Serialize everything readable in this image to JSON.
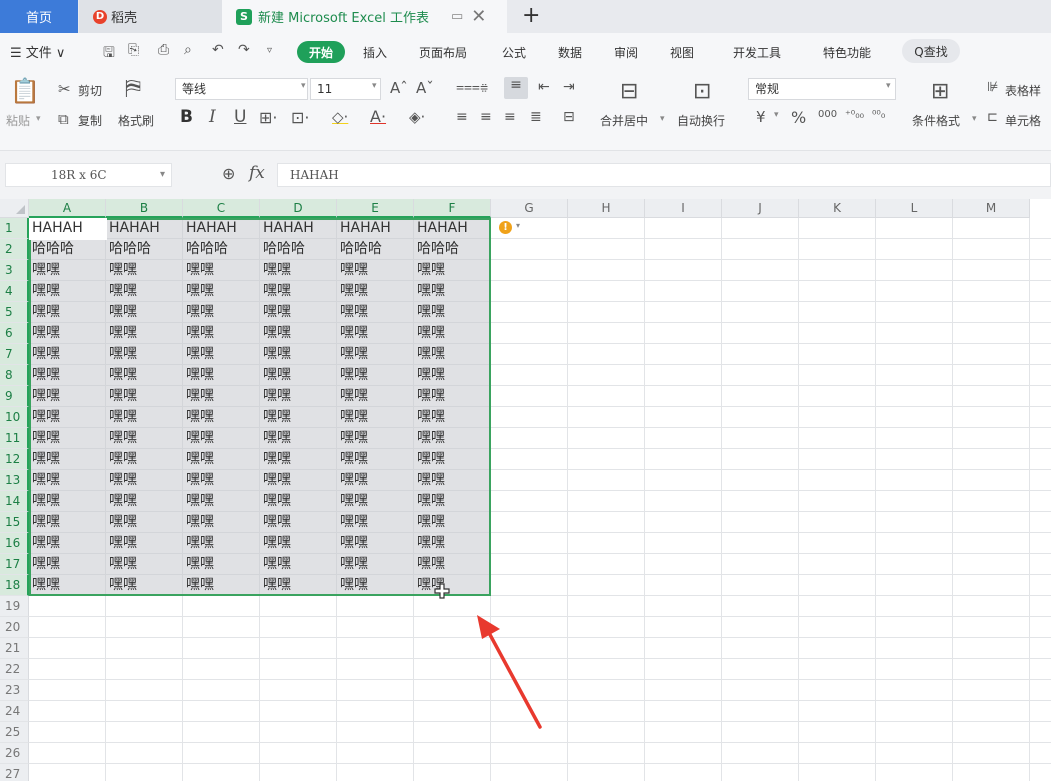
{
  "tabs": {
    "home": "首页",
    "daoke": "稻壳",
    "daoke_logo": "D",
    "excel": "新建 Microsoft Excel 工作表",
    "excel_logo": "S",
    "pin_icon": "▭",
    "close": "✕",
    "add": "+"
  },
  "menu": {
    "file": "☰ 文件 ∨",
    "start": "开始",
    "items": [
      "插入",
      "页面布局",
      "公式",
      "数据",
      "审阅",
      "视图",
      "开发工具",
      "特色功能"
    ],
    "search": "Q查找"
  },
  "ribbon": {
    "paste": "粘贴",
    "cut": "剪切",
    "copy": "复制",
    "format_painter": "格式刷",
    "font_name": "等线",
    "font_size": "11",
    "merge_center": "合并居中",
    "wrap_text": "自动换行",
    "number_format": "常规",
    "currency": "¥",
    "percent": "%",
    "thousands": "000",
    "conditional_format": "条件格式",
    "table_style": "表格样",
    "cell_style": "单元格"
  },
  "formula_bar": {
    "name_box": "18R x 6C",
    "fx": "fx",
    "formula": "HAHAH"
  },
  "grid": {
    "columns": [
      "A",
      "B",
      "C",
      "D",
      "E",
      "F",
      "G",
      "H",
      "I",
      "J",
      "K",
      "L",
      "M"
    ],
    "rows": [
      "1",
      "2",
      "3",
      "4",
      "5",
      "6",
      "7",
      "8",
      "9",
      "10",
      "11",
      "12",
      "13",
      "14",
      "15",
      "16",
      "17",
      "18",
      "19",
      "20",
      "21",
      "22",
      "23",
      "24",
      "25",
      "26",
      "27"
    ],
    "row1": [
      "HAHAH",
      "HAHAH",
      "HAHAH",
      "HAHAH",
      "HAHAH",
      "HAHAH"
    ],
    "row2": [
      "哈哈哈",
      "哈哈哈",
      "哈哈哈",
      "哈哈哈",
      "哈哈哈",
      "哈哈哈"
    ],
    "fill_text": "嘿嘿",
    "selected_columns": 6,
    "selected_rows": 18
  },
  "colors": {
    "accent": "#1fa05a",
    "selection_border": "#3aa35f",
    "arrow": "#e8392e",
    "home_tab": "#3d7bd9"
  }
}
